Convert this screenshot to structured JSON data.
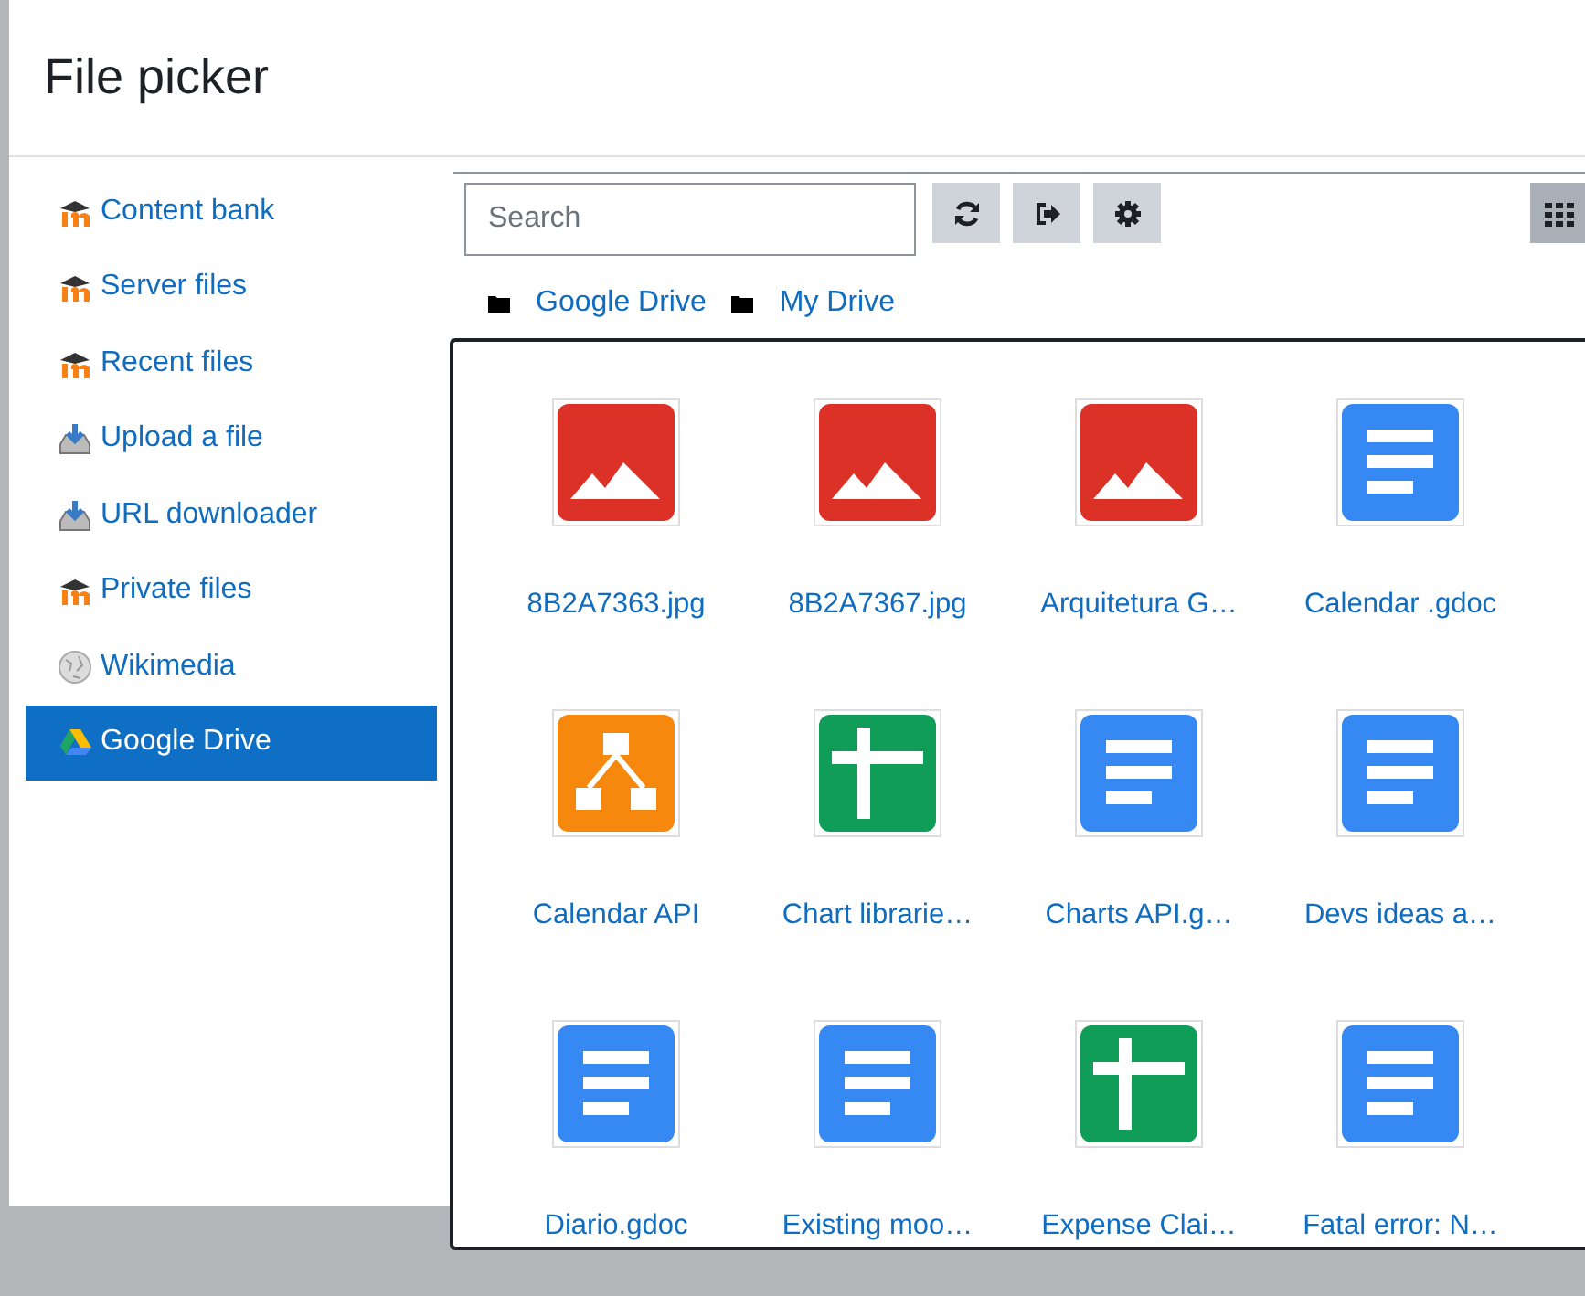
{
  "window": {
    "title": "File picker"
  },
  "sidebar": {
    "items": [
      {
        "label": "Content bank",
        "kind": "moodle",
        "selected": false
      },
      {
        "label": "Server files",
        "kind": "moodle",
        "selected": false
      },
      {
        "label": "Recent files",
        "kind": "moodle",
        "selected": false
      },
      {
        "label": "Upload a file",
        "kind": "upload",
        "selected": false
      },
      {
        "label": "URL downloader",
        "kind": "upload",
        "selected": false
      },
      {
        "label": "Private files",
        "kind": "moodle",
        "selected": false
      },
      {
        "label": "Wikimedia",
        "kind": "globe",
        "selected": false
      },
      {
        "label": "Google Drive",
        "kind": "drive",
        "selected": true
      }
    ]
  },
  "toolbar": {
    "search": {
      "placeholder": "Search"
    },
    "buttons": [
      {
        "kind": "refresh"
      },
      {
        "kind": "logout"
      },
      {
        "kind": "settings"
      }
    ],
    "view_buttons": [
      {
        "kind": "grid",
        "selected": true
      }
    ]
  },
  "breadcrumb": [
    "Google Drive",
    "My Drive"
  ],
  "files": [
    {
      "name": "8B2A7363.jpg",
      "kind": "image"
    },
    {
      "name": "8B2A7367.jpg",
      "kind": "image"
    },
    {
      "name": "Arquitetura G…",
      "kind": "image"
    },
    {
      "name": "Calendar .gdoc",
      "kind": "doc"
    },
    {
      "name": "Calendar API",
      "kind": "diagram"
    },
    {
      "name": "Chart librarie…",
      "kind": "sheet"
    },
    {
      "name": "Charts API.g…",
      "kind": "doc"
    },
    {
      "name": "Devs ideas a…",
      "kind": "doc"
    },
    {
      "name": "Diario.gdoc",
      "kind": "doc"
    },
    {
      "name": "Existing moo…",
      "kind": "doc"
    },
    {
      "name": "Expense Clai…",
      "kind": "sheet"
    },
    {
      "name": "Fatal error: N…",
      "kind": "doc"
    }
  ]
}
